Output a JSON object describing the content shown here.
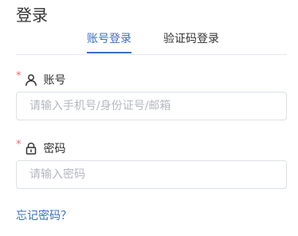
{
  "title": "登录",
  "tabs": [
    {
      "label": "账号登录",
      "active": true
    },
    {
      "label": "验证码登录",
      "active": false
    }
  ],
  "account": {
    "required_mark": "*",
    "icon": "user-icon",
    "label": "账号",
    "placeholder": "请输入手机号/身份证号/邮箱",
    "value": ""
  },
  "password": {
    "required_mark": "*",
    "icon": "lock-icon",
    "label": "密码",
    "placeholder": "请输入密码",
    "value": ""
  },
  "forgot_password": "忘记密码？",
  "colors": {
    "accent": "#3a6fc1",
    "required": "#f56c6c",
    "border": "#dcdfe6",
    "placeholder": "#b4b8bf"
  }
}
